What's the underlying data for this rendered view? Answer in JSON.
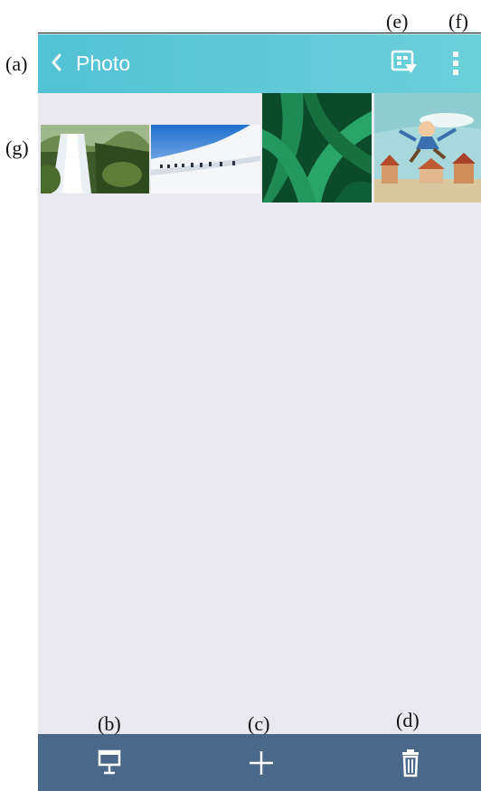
{
  "annotations": {
    "a": "(a)",
    "b": "(b)",
    "c": "(c)",
    "d": "(d)",
    "e": "(e)",
    "f": "(f)",
    "g": "(g)"
  },
  "app_bar": {
    "back_icon": "chevron-left-icon",
    "title": "Photo",
    "actions": [
      {
        "icon": "cast-to-screen-icon"
      },
      {
        "icon": "more-vertical-icon"
      }
    ]
  },
  "photos": [
    {
      "subject": "waterfall",
      "icon": "photo-thumbnail"
    },
    {
      "subject": "white-building",
      "icon": "photo-thumbnail"
    },
    {
      "subject": "green-leaves",
      "icon": "photo-thumbnail"
    },
    {
      "subject": "cartoon-village",
      "icon": "photo-thumbnail"
    }
  ],
  "bottom_bar": {
    "actions": [
      {
        "icon": "slideshow-icon"
      },
      {
        "icon": "add-icon"
      },
      {
        "icon": "trash-icon"
      }
    ]
  },
  "colors": {
    "app_bar": "#52c2d5",
    "background": "#e8e8ee",
    "bottom_bar": "#4a6888"
  }
}
